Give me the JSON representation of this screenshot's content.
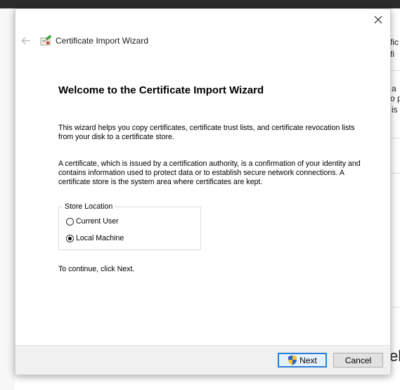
{
  "window": {
    "title": "Certificate Import Wizard",
    "close_icon": "close-icon",
    "back_icon": "back-arrow-icon",
    "title_icon": "certificate-icon"
  },
  "content": {
    "heading": "Welcome to the Certificate Import Wizard",
    "paragraph1": "This wizard helps you copy certificates, certificate trust lists, and certificate revocation lists from your disk to a certificate store.",
    "paragraph2": "A certificate, which is issued by a certification authority, is a confirmation of your identity and contains information used to protect data or to establish secure network connections. A certificate store is the system area where certificates are kept.",
    "store_location": {
      "legend": "Store Location",
      "options": [
        {
          "label": "Current User",
          "selected": false
        },
        {
          "label": "Local Machine",
          "selected": true
        }
      ]
    },
    "continue_text": "To continue, click Next."
  },
  "footer": {
    "next_label": "Next",
    "next_icon": "uac-shield-icon",
    "cancel_label": "Cancel"
  },
  "background": {
    "fragments": [
      "fic",
      "fi",
      "a",
      "o p",
      "is",
      "ele"
    ]
  },
  "colors": {
    "accent": "#2a7fd4",
    "footer_bg": "#f0f0f0",
    "title_bar_dark": "#2b2b2b"
  }
}
